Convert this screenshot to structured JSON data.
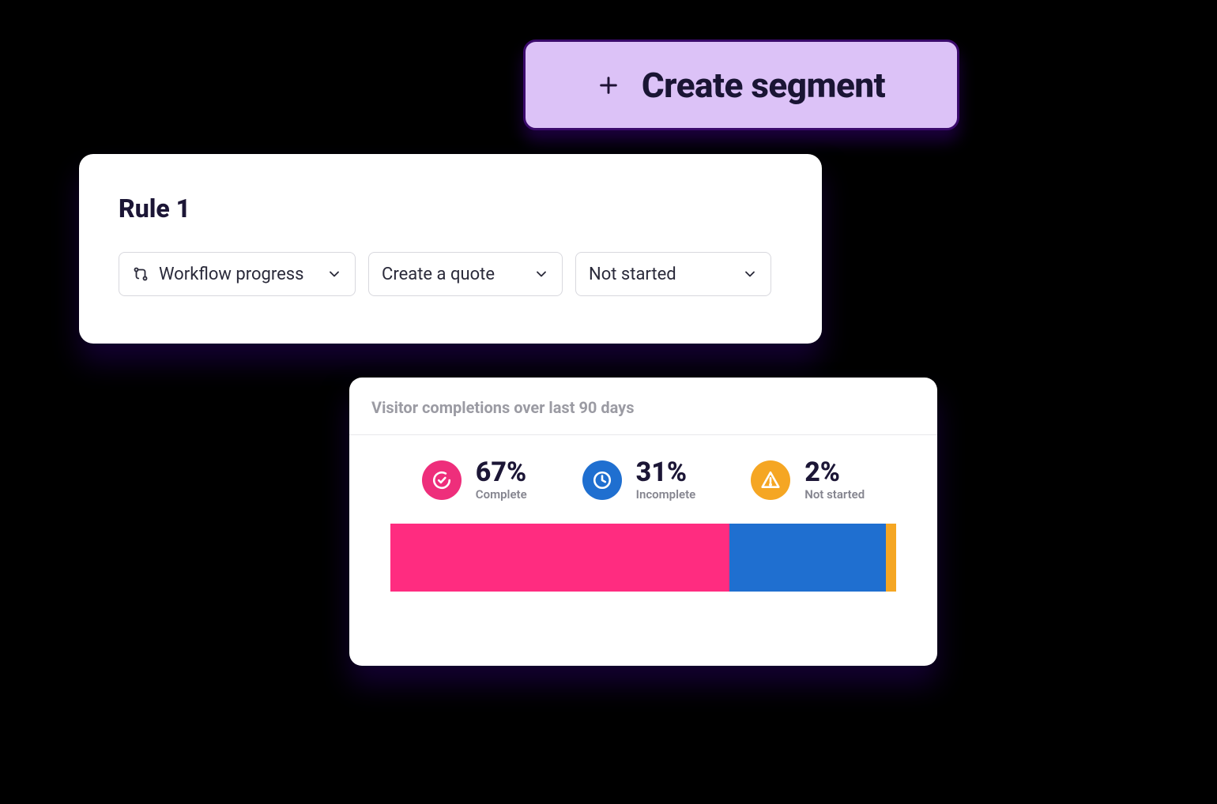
{
  "createSegment": {
    "label": "Create segment"
  },
  "ruleCard": {
    "title": "Rule 1",
    "selects": [
      {
        "label": "Workflow progress",
        "hasIcon": true
      },
      {
        "label": "Create a quote",
        "hasIcon": false
      },
      {
        "label": "Not started",
        "hasIcon": false
      }
    ]
  },
  "completionCard": {
    "title": "Visitor completions over last 90 days",
    "stats": [
      {
        "value": "67%",
        "label": "Complete",
        "colorClass": "c-pink",
        "icon": "check"
      },
      {
        "value": "31%",
        "label": "Incomplete",
        "colorClass": "c-blue",
        "icon": "clock"
      },
      {
        "value": "2%",
        "label": "Not started",
        "colorClass": "c-orange",
        "icon": "alert"
      }
    ]
  },
  "chart_data": {
    "type": "bar",
    "orientation": "stacked-horizontal",
    "categories": [
      "Complete",
      "Incomplete",
      "Not started"
    ],
    "values": [
      67,
      31,
      2
    ],
    "colors": [
      "#ff2c80",
      "#1f6fd0",
      "#f5a623"
    ],
    "title": "Visitor completions over last 90 days",
    "unit": "percent",
    "ylim": [
      0,
      100
    ]
  }
}
